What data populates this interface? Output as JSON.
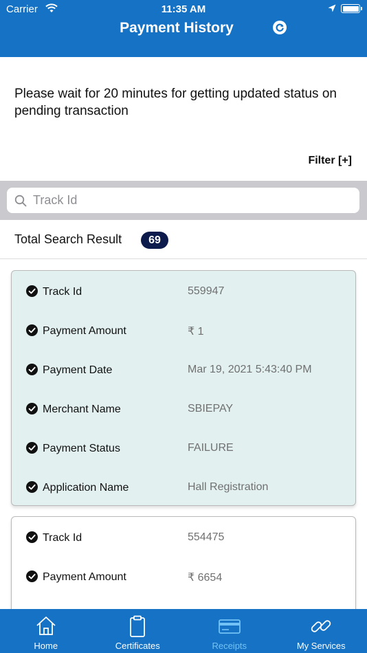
{
  "status_bar": {
    "carrier": "Carrier",
    "time": "11:35 AM"
  },
  "header": {
    "title": "Payment History"
  },
  "notice": "Please wait for 20 minutes for getting updated status on pending transaction",
  "filter": {
    "label": "Filter [+]"
  },
  "search": {
    "placeholder": "Track Id",
    "value": ""
  },
  "results": {
    "label": "Total Search Result",
    "count": "69"
  },
  "cards": [
    {
      "rows": [
        {
          "label": "Track Id",
          "value": "559947"
        },
        {
          "label": "Payment Amount",
          "value": "₹ 1"
        },
        {
          "label": "Payment Date",
          "value": "Mar 19, 2021 5:43:40 PM"
        },
        {
          "label": "Merchant Name",
          "value": "SBIEPAY"
        },
        {
          "label": "Payment Status",
          "value": "FAILURE"
        },
        {
          "label": "Application Name",
          "value": "Hall Registration"
        }
      ]
    },
    {
      "rows": [
        {
          "label": "Track Id",
          "value": "554475"
        },
        {
          "label": "Payment Amount",
          "value": "₹ 6654"
        }
      ]
    }
  ],
  "tabs": [
    {
      "label": "Home",
      "icon": "home-icon"
    },
    {
      "label": "Certificates",
      "icon": "clipboard-icon"
    },
    {
      "label": "Receipts",
      "icon": "card-icon",
      "selected": true
    },
    {
      "label": "My Services",
      "icon": "link-icon"
    }
  ],
  "colors": {
    "brand_blue": "#1672c4",
    "selected_tab": "#72c2f5",
    "badge": "#0d1b4c",
    "active_card": "#e2f0f0"
  }
}
